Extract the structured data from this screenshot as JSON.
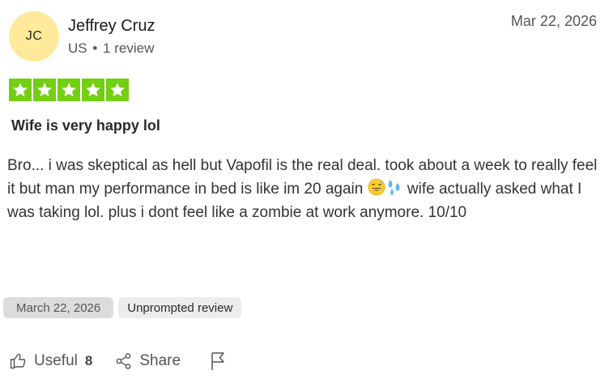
{
  "review": {
    "author": {
      "initials": "JC",
      "name": "Jeffrey Cruz",
      "country": "US",
      "review_count": "1 review"
    },
    "date": "Mar 22, 2026",
    "rating": 5,
    "title": "Wife is very happy lol",
    "body_part1": "Bro... i was skeptical as hell but Vapofil is the real deal. took about a week to really feel it but man my performance in bed is like im 20 again ",
    "body_part2": " wife actually asked what I was taking lol. plus i dont feel like a zombie at work anymore. 10/10",
    "emoji": [
      "grinning-sweat-emoji",
      "sweat-droplets-emoji"
    ],
    "date_chip": "March 22, 2026",
    "unprompted_chip": "Unprompted review"
  },
  "actions": {
    "useful_label": "Useful",
    "useful_count": "8",
    "share_label": "Share",
    "icons": [
      "thumbs-up-icon",
      "share-icon",
      "flag-icon"
    ]
  },
  "colors": {
    "star_green": "#73cf11",
    "avatar_bg": "#ffe99a",
    "chip_bg": "#dcdcdc"
  }
}
